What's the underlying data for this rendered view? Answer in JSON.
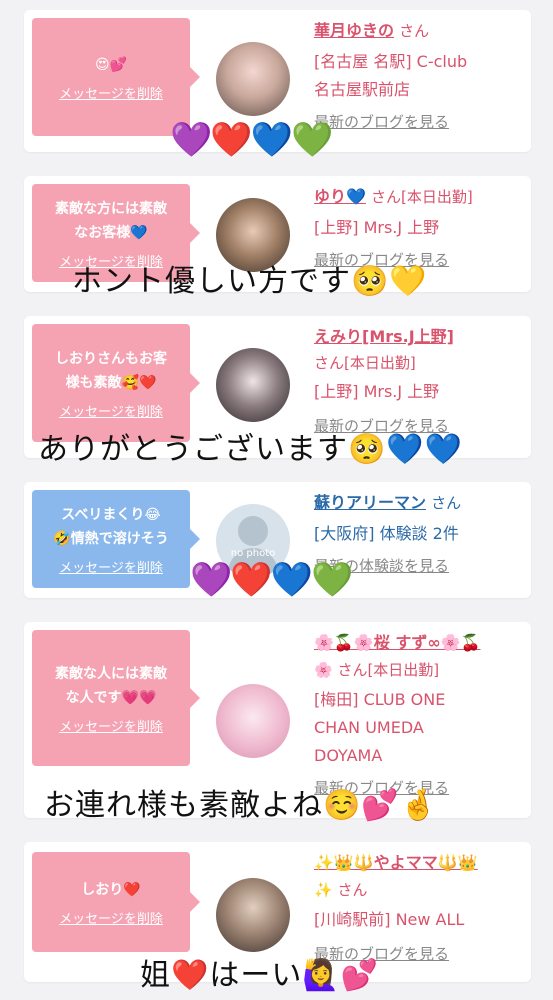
{
  "delete_label": "メッセージを削除",
  "cards": [
    {
      "message": "😍💕",
      "name": "華月ゆきの",
      "san": "さん",
      "shop": "[名古屋 名駅] C-club\n名古屋駅前店",
      "blog": "最新のブログを見る"
    },
    {
      "message": "素敵な方には素敵\nなお客様💙",
      "name": "ゆり💙",
      "san": "さん[本日出勤]",
      "shop": "[上野] Mrs.J 上野",
      "blog": "最新のブログを見る"
    },
    {
      "message": "しおりさんもお客\n様も素敵🥰❤️",
      "name": "えみり[Mrs.J上野]",
      "san": "さん[本日出勤]",
      "shop": "[上野] Mrs.J 上野",
      "blog": "最新のブログを見る"
    },
    {
      "message": "スベリまくり😂\n🤣情熱で溶けそう",
      "name": "蘇りアリーマン",
      "san": "さん",
      "shop": "[大阪府] 体験談 2件",
      "blog": "最新の体験談を見る",
      "avatar_text": "no photo"
    },
    {
      "message": "素敵な人には素敵\nな人です💗💗",
      "name": "🌸🍒🌸桜 すず∞🌸🍒",
      "san": "🌸 さん[本日出勤]",
      "shop": "[梅田] CLUB ONE\nCHAN UMEDA\nDOYAMA",
      "blog": "最新のブログを見る"
    },
    {
      "message": "しおり❤️",
      "name": "✨👑🔱やよママ🔱👑",
      "san": "✨ さん",
      "shop": "[川崎駅前] New ALL",
      "blog": "最新のブログを見る"
    }
  ],
  "overlays": {
    "hearts1": "💜❤️💙💚",
    "text2": "ホント優しい方です🥺💛",
    "text3": "ありがとうございます🥺💙💙",
    "hearts4": "💜❤️💙💚",
    "text5": "お連れ様も素敵よね☺️💕🤞",
    "text6": "姐❤️はーい🙋‍♀️💕"
  }
}
